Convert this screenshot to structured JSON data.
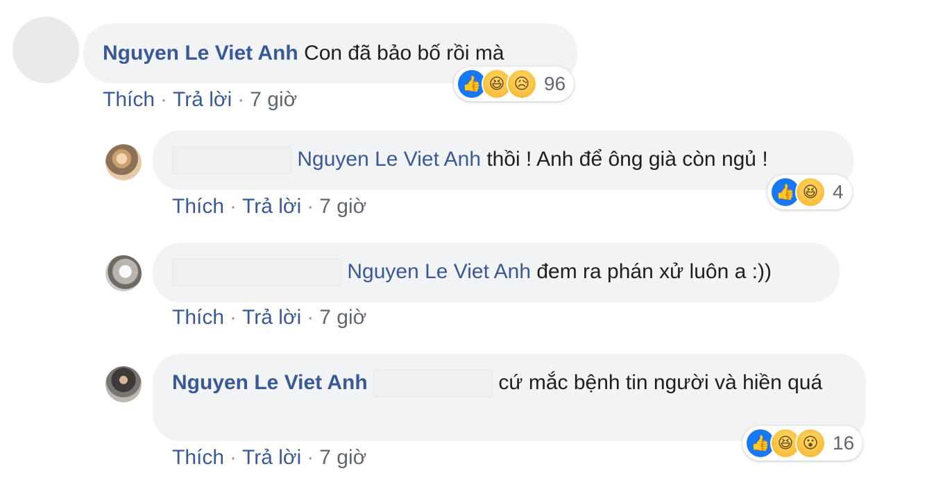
{
  "comments": [
    {
      "author": "Nguyen Le Viet Anh",
      "text": "Con đã bảo bố rồi mà",
      "actions": {
        "like": "Thích",
        "reply": "Trả lời",
        "sep": "·",
        "time": "7 giờ"
      },
      "reactions": {
        "types": [
          "like-icon",
          "haha-icon",
          "sad-icon"
        ],
        "count": "96"
      }
    },
    {
      "mention": "Nguyen Le Viet Anh",
      "text": "thồi ! Anh để ông già còn ngủ !",
      "actions": {
        "like": "Thích",
        "reply": "Trả lời",
        "sep": "·",
        "time": "7 giờ"
      },
      "reactions": {
        "types": [
          "like-icon",
          "haha-icon"
        ],
        "count": "4"
      }
    },
    {
      "mention": "Nguyen Le Viet Anh",
      "text": "đem ra phán xử luôn a :))",
      "actions": {
        "like": "Thích",
        "reply": "Trả lời",
        "sep": "·",
        "time": "7 giờ"
      }
    },
    {
      "author": "Nguyen Le Viet Anh",
      "text": "cứ mắc bệnh tin người và hiền quá",
      "actions": {
        "like": "Thích",
        "reply": "Trả lời",
        "sep": "·",
        "time": "7 giờ"
      },
      "reactions": {
        "types": [
          "like-icon",
          "haha-icon",
          "wow-icon"
        ],
        "count": "16"
      }
    }
  ],
  "colors": {
    "link": "#385898",
    "bubble": "#f2f3f5",
    "like": "#1877f2"
  }
}
